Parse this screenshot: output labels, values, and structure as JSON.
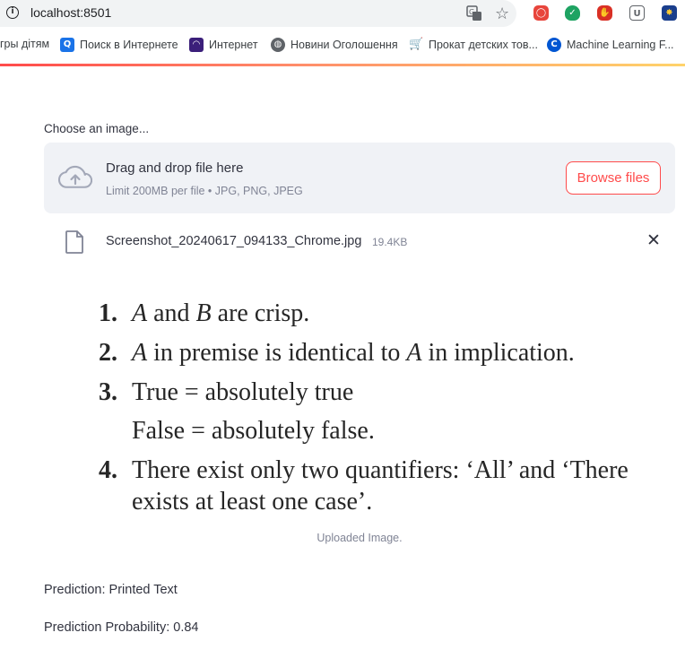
{
  "browser": {
    "url": "localhost:8501",
    "bookmarks": [
      {
        "label": "гры дітям",
        "icon": "folder-icon"
      },
      {
        "label": "Поиск в Интернете",
        "icon": "search-icon",
        "color": "#1a73e8"
      },
      {
        "label": "Интернет",
        "icon": "site-icon",
        "color": "#3b1f7a"
      },
      {
        "label": "Новини Оголошення",
        "icon": "globe-icon",
        "color": "#5f6368"
      },
      {
        "label": "Прокат детских тов...",
        "icon": "cart-icon",
        "color": "#5f6368"
      },
      {
        "label": "Machine Learning F...",
        "icon": "coursera-icon",
        "color": "#0056d2"
      }
    ],
    "extensions": [
      {
        "name": "adblock-icon",
        "color": "#e8453c"
      },
      {
        "name": "shield-check-icon",
        "color": "#1ea362"
      },
      {
        "name": "stop-hand-icon",
        "color": "#d93025"
      },
      {
        "name": "bitwarden-icon",
        "color": "#5f6368"
      },
      {
        "name": "extension-icon",
        "color": "#1a3e8c"
      }
    ]
  },
  "uploader": {
    "label": "Choose an image...",
    "dropzone_title": "Drag and drop file here",
    "dropzone_limit": "Limit 200MB per file • JPG, PNG, JPEG",
    "browse_label": "Browse files"
  },
  "file": {
    "name": "Screenshot_20240617_094133_Chrome.jpg",
    "size": "19.4KB"
  },
  "image": {
    "items": [
      {
        "num": "1.",
        "text": "A and B are crisp."
      },
      {
        "num": "2.",
        "text": "A in premise is identical to A in implication."
      },
      {
        "num": "3.",
        "text": "True = absolutely true"
      },
      {
        "num": "",
        "text": "False = absolutely false."
      },
      {
        "num": "4.",
        "text": "There exist only two quantifiers: ‘All’ and ‘There"
      },
      {
        "num": "",
        "text": "exists at least one case’."
      }
    ],
    "caption": "Uploaded Image."
  },
  "results": {
    "prediction": "Prediction: Printed Text",
    "probability": "Prediction Probability: 0.84"
  },
  "colors": {
    "accent": "#ff4b4b",
    "dropzone_bg": "#f0f2f6",
    "muted_text": "#808495"
  }
}
